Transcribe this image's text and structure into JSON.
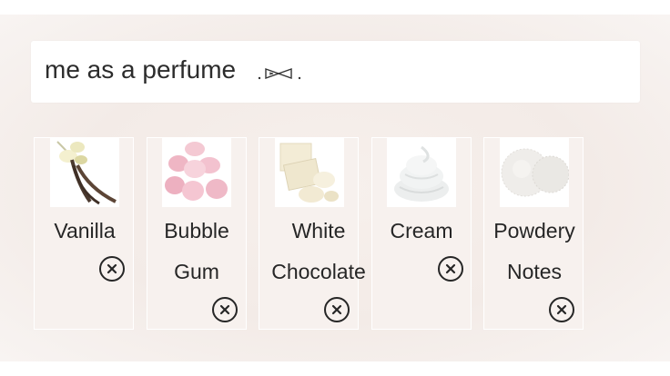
{
  "title": {
    "text": "me as a perfume"
  },
  "notes": [
    {
      "label_line1": "Vanilla",
      "label_line2": "",
      "icon": "vanilla-image"
    },
    {
      "label_line1": "Bubble",
      "label_line2": "Gum",
      "icon": "marshmallow-image"
    },
    {
      "label_line1": "White",
      "label_line2": "Chocolate",
      "icon": "white-chocolate-image"
    },
    {
      "label_line1": "Cream",
      "label_line2": "",
      "icon": "whipped-cream-image"
    },
    {
      "label_line1": "Powdery",
      "label_line2": "Notes",
      "icon": "powder-image"
    }
  ],
  "remove_icon": "close-circle-icon",
  "colors": {
    "card_bg": "#f7f1ee",
    "text": "#262626",
    "background": "#f3ebe7"
  }
}
